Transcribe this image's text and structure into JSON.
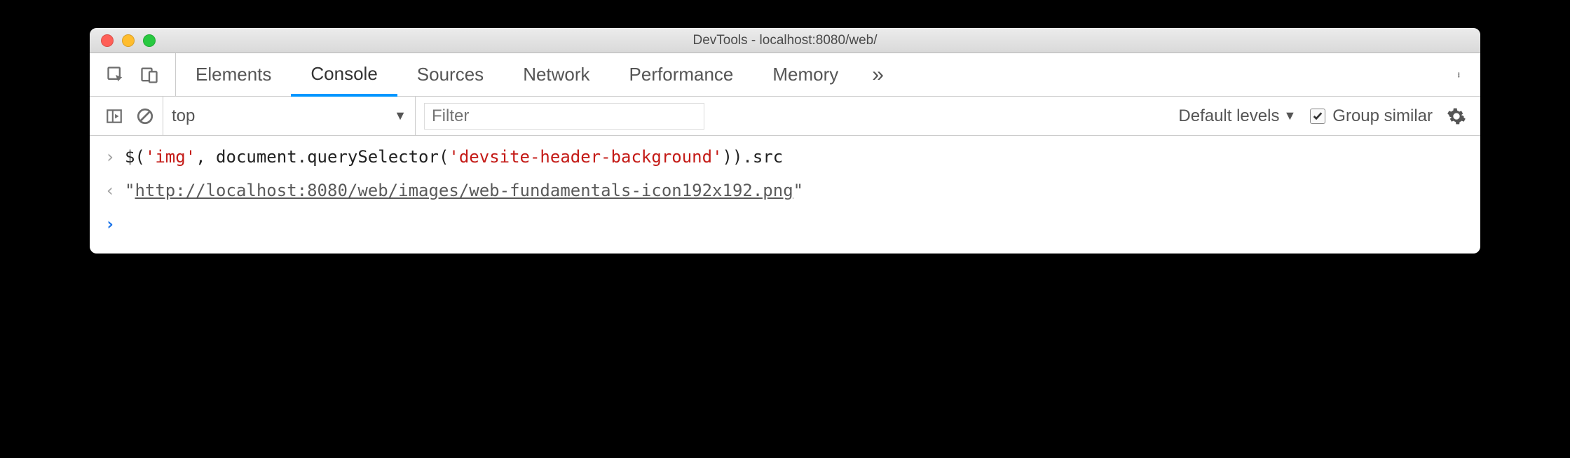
{
  "window": {
    "title": "DevTools - localhost:8080/web/"
  },
  "tabs": {
    "elements": "Elements",
    "console": "Console",
    "sources": "Sources",
    "network": "Network",
    "performance": "Performance",
    "memory": "Memory"
  },
  "toolbar": {
    "context": "top",
    "filter_placeholder": "Filter",
    "levels": "Default levels",
    "group_similar_label": "Group similar",
    "group_similar_checked": true
  },
  "console": {
    "input_code": {
      "p1": "$(",
      "s1": "'img'",
      "p2": ", document.querySelector(",
      "s2": "'devsite-header-background'",
      "p3": ")).src"
    },
    "output": {
      "q1": "\"",
      "url": "http://localhost:8080/web/images/web-fundamentals-icon192x192.png",
      "q2": "\""
    }
  }
}
